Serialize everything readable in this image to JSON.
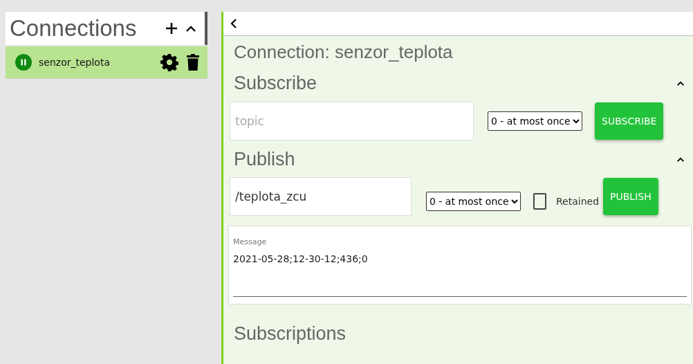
{
  "sidebar": {
    "title": "Connections",
    "connections": [
      {
        "name": "senzor_teplota",
        "selected": true,
        "connected": true
      }
    ]
  },
  "main": {
    "title": "Connection: senzor_teplota",
    "subscribe": {
      "heading": "Subscribe",
      "expanded": true,
      "topic": {
        "placeholder": "topic"
      },
      "qos": "0 - at most once",
      "button": "SUBSCRIBE"
    },
    "publish": {
      "heading": "Publish",
      "expanded": true,
      "topic": {
        "value": "/teplota_zcu"
      },
      "qos": "0 - at most once",
      "retained": {
        "label": "Retained",
        "checked": false
      },
      "button": "PUBLISH",
      "message": {
        "label": "Message",
        "value": "2021-05-28;12-30-12;436;0"
      }
    },
    "subscriptions": {
      "heading": "Subscriptions"
    }
  }
}
